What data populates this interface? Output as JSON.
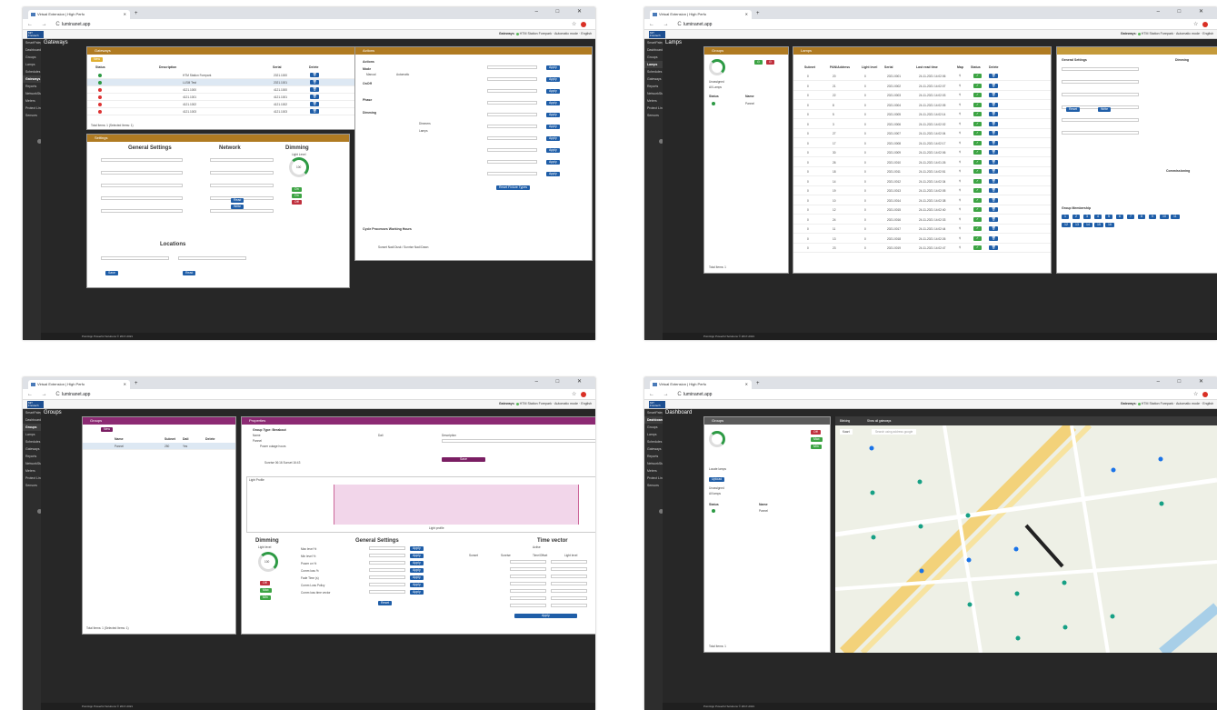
{
  "browser": {
    "tab_title": "Virtual Extension | High Perfo",
    "url": "luminanet.app",
    "new_tab": "+",
    "win_controls": "– □ ✕",
    "nav": "← → C"
  },
  "app": {
    "logo": "MiT  Frevtech",
    "gateway_label": "Gateways",
    "gateway_name": "HTM Station Forepark",
    "mode": "Automatic mode",
    "lang": "English",
    "footer": "PointApp Powerful Solutions © 2017-2021"
  },
  "sidebar": [
    "SmartPalegison",
    "Dashboard",
    "Groups",
    "Lamps",
    "Schedules",
    "Gateways",
    "Reports",
    "NetworkStats",
    "Meters",
    "Protect Line",
    "Sensors"
  ],
  "s1": {
    "title": "Gateways",
    "gw_panel": "Gateways",
    "new_btn": "New",
    "cols": [
      "Status",
      "Description",
      "Serial",
      "Delete"
    ],
    "rows": [
      {
        "desc": "HTM Station Forepark",
        "serial": "2021.1000",
        "status": "#2d9a44"
      },
      {
        "desc": "LLSM Test",
        "serial": "2021.1001",
        "status": "#2d9a44"
      },
      {
        "desc": "4121.1000",
        "serial": "4121.1000",
        "status": "#d33"
      },
      {
        "desc": "4121.1001",
        "serial": "4121.1001",
        "status": "#d33"
      },
      {
        "desc": "4121.1002",
        "serial": "4121.1002",
        "status": "#d33"
      },
      {
        "desc": "4121.1003",
        "serial": "4121.1003",
        "status": "#d33"
      }
    ],
    "total": "Total Items: 1 (Selected Items: 1)",
    "settings_panel": "Settings",
    "general": "General Settings",
    "network": "Network",
    "dimming": "Dimming",
    "light_level": "Light Level",
    "gauge_val": "100",
    "locations": "Locations",
    "save": "Save",
    "read": "Read",
    "write": "Write",
    "on": "On",
    "off": "Off",
    "actions_panel": "Actions",
    "actions": "Actions",
    "mode": "Mode",
    "manual": "Manual",
    "automatic": "Automatic",
    "onoff": "OnOff",
    "phase": "Phase",
    "dimming_lbl": "Dimming",
    "apply": "Apply",
    "lbl_dimmers": "Dimmers",
    "lbl_lamps": "Lamps",
    "reset_fixture": "Reset Fixture Types",
    "cycle": "Cycle Processes Working Hours",
    "sunset": "Sunset Nadi Dusk / Sunrise Nadi Dawn"
  },
  "s2": {
    "title": "Lamps",
    "groups_panel": "Groups",
    "lamps_panel": "Lamps",
    "unassigned": "Unassigned",
    "all_lamps": "All Lamps",
    "status": "Status",
    "name": "Name",
    "name_val": "Pannel",
    "total": "Total Items: 1",
    "cols": [
      "Subnet",
      "PAN/Address",
      "Light level",
      "Serial",
      "Last read time",
      "Map",
      "Status",
      "Delete"
    ],
    "rows": [
      [
        "0",
        "20",
        "0",
        "2021.0001",
        "24-11-2021 14:02:06"
      ],
      [
        "0",
        "21",
        "0",
        "2021.0002",
        "24-11-2021 14:02:07"
      ],
      [
        "0",
        "22",
        "0",
        "2021.0003",
        "24-11-2021 14:02:03"
      ],
      [
        "0",
        "8",
        "0",
        "2021.0004",
        "24-11-2021 14:02:05"
      ],
      [
        "0",
        "5",
        "0",
        "2021.0005",
        "24-11-2021 14:02:14"
      ],
      [
        "0",
        "3",
        "0",
        "2021.0006",
        "24-11-2021 14:02:02"
      ],
      [
        "0",
        "27",
        "0",
        "2021.0007",
        "24-11-2021 14:02:04"
      ],
      [
        "0",
        "17",
        "0",
        "2021.0008",
        "24-11-2021 14:02:17"
      ],
      [
        "0",
        "30",
        "0",
        "2021.0009",
        "24-11-2021 14:02:06"
      ],
      [
        "0",
        "26",
        "0",
        "2021.0010",
        "24-11-2021 14:01:26"
      ],
      [
        "0",
        "18",
        "0",
        "2021.0011",
        "24-11-2021 14:02:51"
      ],
      [
        "0",
        "14",
        "0",
        "2021.0012",
        "24-11-2021 14:02:34"
      ],
      [
        "0",
        "19",
        "0",
        "2021.0013",
        "24-11-2021 14:02:05"
      ],
      [
        "0",
        "10",
        "0",
        "2021.0014",
        "24-11-2021 14:02:38"
      ],
      [
        "0",
        "12",
        "0",
        "2021.0015",
        "24-11-2021 14:02:40"
      ],
      [
        "0",
        "24",
        "0",
        "2021.0016",
        "24-11-2021 14:02:33"
      ],
      [
        "0",
        "11",
        "0",
        "2021.0017",
        "24-11-2021 14:02:44"
      ],
      [
        "0",
        "13",
        "0",
        "2021.0018",
        "24-11-2021 14:02:26"
      ],
      [
        "0",
        "23",
        "0",
        "2021.0019",
        "24-11-2021 14:02:47"
      ]
    ],
    "general": "General Settings",
    "dimming": "Dimming",
    "commissioning": "Commissioning",
    "group_membership": "Group Membership",
    "reset": "Reset",
    "write": "Write",
    "groups_nums": [
      "1",
      "2",
      "3",
      "4",
      "5",
      "6",
      "7",
      "8",
      "9",
      "10",
      "11",
      "12",
      "13",
      "14",
      "15",
      "16"
    ]
  },
  "s3": {
    "title": "Groups",
    "groups_panel": "Groups",
    "props_panel": "Properties",
    "new": "New",
    "cols": [
      "Name",
      "Subnet",
      "Dali",
      "Delete"
    ],
    "row": [
      "Pannel",
      "250",
      "Yes"
    ],
    "total": "Total Items: 1 (Selected Items: 1)",
    "group_type": "Group Type: Breakout",
    "name_lbl": "Name",
    "name_val": "Pannel",
    "dali_lbl": "Dali",
    "desc_lbl": "Description",
    "power_outage": "Power outage hours",
    "sun_lbl": "Sunrise 06:16 Sunset 16:43",
    "save": "Save",
    "light_profile": "Light Profile",
    "legend": "Light profile",
    "dimming": "Dimming",
    "general": "General Settings",
    "time_vector": "Time vector",
    "active": "Active",
    "light_level": "Light level",
    "gauge_val": "100",
    "settings": [
      "Max level %",
      "Min level %",
      "Power on %",
      "Comm loss %",
      "Fade Time (s)",
      "Comm Loss Policy",
      "Comm loss time vector"
    ],
    "apply": "Apply",
    "reset": "Reset",
    "off": "Off",
    "max": "Max",
    "min": "Min",
    "tv_cols": [
      "Sunset",
      "Sunrise",
      "Time/Offset",
      "Light level"
    ]
  },
  "s4": {
    "title": "Dashboard",
    "groups_panel": "Groups",
    "blinking": "Blinking",
    "show_all": "Show all gateways",
    "kaart": "Kaart",
    "search_ph": "Search using address google",
    "locate": "Locate lamps",
    "unassigned": "Unassigned",
    "all_lamps": "All lamps",
    "status": "Status",
    "name": "Name",
    "name_val": "Pannel",
    "total": "Total Items: 1",
    "off": "Off",
    "max": "Max",
    "min": "Min",
    "upload": "Upload"
  }
}
